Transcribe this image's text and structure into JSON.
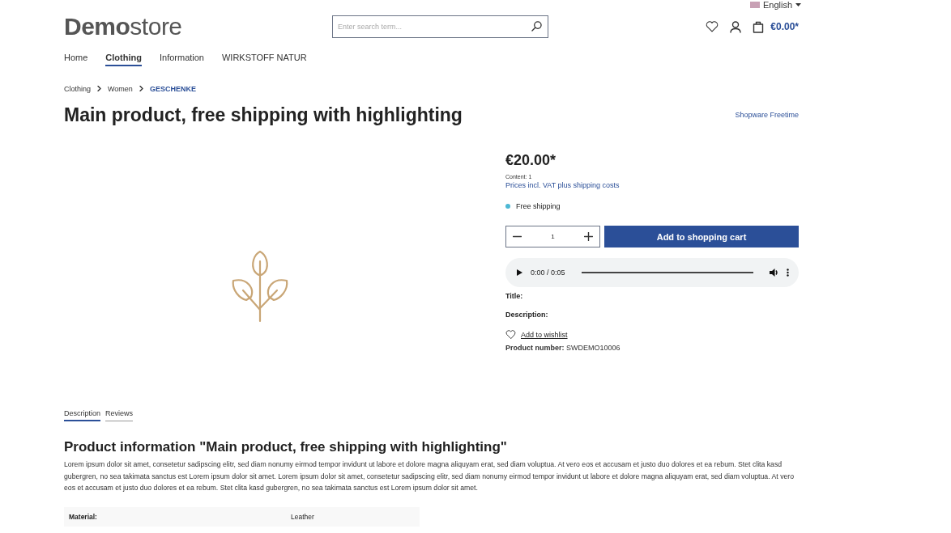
{
  "language": {
    "label": "English"
  },
  "logo": {
    "bold": "Demo",
    "light": "store"
  },
  "search": {
    "placeholder": "Enter search term..."
  },
  "cart": {
    "total": "€0.00*"
  },
  "nav": [
    {
      "label": "Home",
      "selected": false
    },
    {
      "label": "Clothing",
      "selected": true
    },
    {
      "label": "Information",
      "selected": false
    },
    {
      "label": "WIRKSTOFF NATUR",
      "selected": false
    }
  ],
  "breadcrumb": [
    {
      "label": "Clothing",
      "selected": false
    },
    {
      "label": "Women",
      "selected": false
    },
    {
      "label": "GESCHENKE",
      "selected": true
    }
  ],
  "product": {
    "title": "Main product, free shipping with highlighting",
    "manufacturer": "Shopware Freetime",
    "price": "€20.00*",
    "content": "Content: 1",
    "tax_note": "Prices incl. VAT plus shipping costs",
    "shipping": {
      "label": "Free shipping",
      "color": "#4db8d4"
    },
    "quantity": "1",
    "add_to_cart": "Add to shopping cart",
    "audio": {
      "time": "0:00 / 0:05"
    },
    "title_label": "Title:",
    "description_label": "Description:",
    "wishlist": "Add to wishlist",
    "number_label": "Product number:",
    "number": "SWDEMO10006"
  },
  "tabs": [
    {
      "label": "Description",
      "selected": true
    },
    {
      "label": "Reviews",
      "selected": false
    }
  ],
  "description": {
    "heading": "Product information \"Main product, free shipping with highlighting\"",
    "text": "Lorem ipsum dolor sit amet, consetetur sadipscing elitr, sed diam nonumy eirmod tempor invidunt ut labore et dolore magna aliquyam erat, sed diam voluptua. At vero eos et accusam et justo duo dolores et ea rebum. Stet clita kasd gubergren, no sea takimata sanctus est Lorem ipsum dolor sit amet. Lorem ipsum dolor sit amet, consetetur sadipscing elitr, sed diam nonumy eirmod tempor invidunt ut labore et dolore magna aliquyam erat, sed diam voluptua. At vero eos et accusam et justo duo dolores et ea rebum. Stet clita kasd gubergren, no sea takimata sanctus est Lorem ipsum dolor sit amet."
  },
  "properties": [
    {
      "name": "Material:",
      "value": "Leather"
    }
  ]
}
